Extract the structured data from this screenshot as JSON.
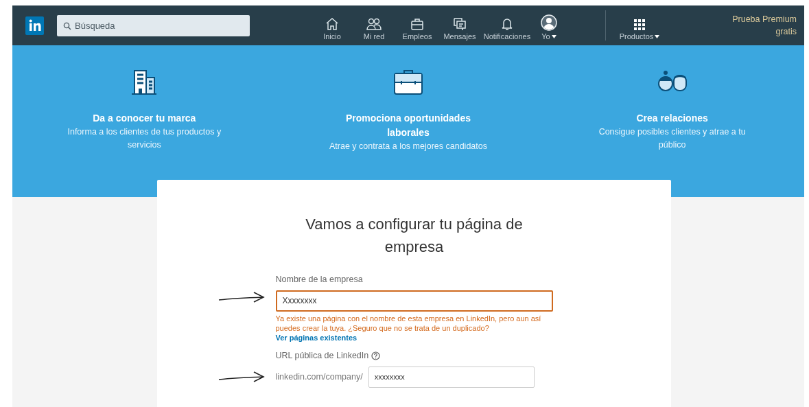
{
  "navbar": {
    "search": {
      "placeholder": "Búsqueda"
    },
    "items": [
      {
        "label": "Inicio",
        "kind": "home",
        "selected": false
      },
      {
        "label": "Mi red",
        "kind": "network",
        "selected": false
      },
      {
        "label": "Empleos",
        "kind": "jobs",
        "selected": false
      },
      {
        "label": "Mensajes",
        "kind": "messages",
        "selected": false
      },
      {
        "label": "Notificaciones",
        "kind": "bell",
        "selected": false
      },
      {
        "label": "Yo",
        "kind": "avatar",
        "selected": false,
        "dropdown": true
      },
      {
        "label": "Productos",
        "kind": "grid",
        "selected": false,
        "dropdown": true
      }
    ],
    "premium": [
      "Prueba Premium",
      "gratis"
    ]
  },
  "features": [
    {
      "kind": "building",
      "title": "Da a conocer tu marca",
      "text": "Informa a los clientes de tus productos y servicios"
    },
    {
      "kind": "briefcase",
      "title": "Promociona oportunidades laborales",
      "text": "Atrae y contrata a los mejores candidatos"
    },
    {
      "kind": "people",
      "title": "Crea relaciones",
      "text": "Consigue posibles clientes y atrae a tu público"
    }
  ],
  "form": {
    "title": "Vamos a configurar tu página de empresa",
    "company_name": {
      "label": "Nombre de la empresa",
      "value": "Xxxxxxxx",
      "error": true,
      "message": "Ya existe una página con el nombre de esta empresa en LinkedIn, pero aun así puedes crear la tuya. ¿Seguro que no se trata de un duplicado?",
      "link": "Ver páginas existentes"
    },
    "url": {
      "label": "URL pública de LinkedIn",
      "prefix": "linkedin.com/company/",
      "value": "xxxxxxxx",
      "help": true
    }
  }
}
